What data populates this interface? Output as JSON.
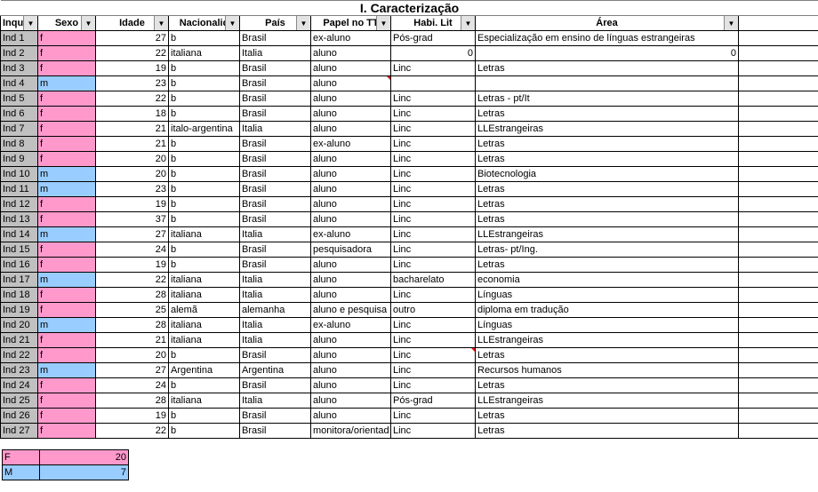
{
  "title": "I. Caracterização",
  "headers": {
    "id": "Inquiric",
    "sexo": "Sexo",
    "idade": "Idade",
    "nac": "Nacionalid",
    "pais": "País",
    "papel": "Papel no TT",
    "habi": "Habi. Lit",
    "area": "Área"
  },
  "rows": [
    {
      "id": "Ind 1",
      "sexo": "f",
      "idade": "27",
      "nac": "b",
      "pais": "Brasil",
      "papel": "ex-aluno",
      "habi": "Pós-grad",
      "area": "Especialização em ensino de línguas estrangeiras"
    },
    {
      "id": "Ind 2",
      "sexo": "f",
      "idade": "22",
      "nac": "italiana",
      "pais": "Italia",
      "papel": "aluno",
      "habi": "0",
      "area": "0",
      "habi_num": true,
      "area_num": true
    },
    {
      "id": "Ind 3",
      "sexo": "f",
      "idade": "19",
      "nac": "b",
      "pais": "Brasil",
      "papel": "aluno",
      "habi": "Linc",
      "area": "Letras"
    },
    {
      "id": "Ind 4",
      "sexo": "m",
      "idade": "23",
      "nac": "b",
      "pais": "Brasil",
      "papel": "aluno",
      "habi": "",
      "area": "",
      "papel_mark": true
    },
    {
      "id": "Ind 5",
      "sexo": "f",
      "idade": "22",
      "nac": "b",
      "pais": "Brasil",
      "papel": "aluno",
      "habi": "Linc",
      "area": "Letras - pt/It"
    },
    {
      "id": "Ind 6",
      "sexo": "f",
      "idade": "18",
      "nac": "b",
      "pais": "Brasil",
      "papel": "aluno",
      "habi": "Linc",
      "area": "Letras"
    },
    {
      "id": "Ind 7",
      "sexo": "f",
      "idade": "21",
      "nac": "italo-argentina",
      "pais": "Italia",
      "papel": "aluno",
      "habi": "Linc",
      "area": "LLEstrangeiras"
    },
    {
      "id": "Ind 8",
      "sexo": "f",
      "idade": "21",
      "nac": "b",
      "pais": "Brasil",
      "papel": "ex-aluno",
      "habi": "Linc",
      "area": "Letras"
    },
    {
      "id": "Ind 9",
      "sexo": "f",
      "idade": "20",
      "nac": "b",
      "pais": "Brasil",
      "papel": "aluno",
      "habi": "Linc",
      "area": "Letras"
    },
    {
      "id": "Ind 10",
      "sexo": "m",
      "idade": "20",
      "nac": "b",
      "pais": "Brasil",
      "papel": "aluno",
      "habi": "Linc",
      "area": "Biotecnologia"
    },
    {
      "id": "Ind 11",
      "sexo": "m",
      "idade": "23",
      "nac": "b",
      "pais": "Brasil",
      "papel": "aluno",
      "habi": "Linc",
      "area": "Letras"
    },
    {
      "id": "Ind 12",
      "sexo": "f",
      "idade": "19",
      "nac": "b",
      "pais": "Brasil",
      "papel": "aluno",
      "habi": "Linc",
      "area": "Letras"
    },
    {
      "id": "Ind 13",
      "sexo": "f",
      "idade": "37",
      "nac": "b",
      "pais": "Brasil",
      "papel": "aluno",
      "habi": "Linc",
      "area": "Letras"
    },
    {
      "id": "Ind 14",
      "sexo": "m",
      "idade": "27",
      "nac": "italiana",
      "pais": "Italia",
      "papel": "ex-aluno",
      "habi": "Linc",
      "area": "LLEstrangeiras"
    },
    {
      "id": "Ind 15",
      "sexo": "f",
      "idade": "24",
      "nac": "b",
      "pais": "Brasil",
      "papel": "pesquisadora",
      "habi": "Linc",
      "area": "Letras- pt/Ing."
    },
    {
      "id": "Ind 16",
      "sexo": "f",
      "idade": "19",
      "nac": "b",
      "pais": "Brasil",
      "papel": "aluno",
      "habi": "Linc",
      "area": "Letras"
    },
    {
      "id": "Ind 17",
      "sexo": "m",
      "idade": "22",
      "nac": "italiana",
      "pais": "Italia",
      "papel": "aluno",
      "habi": "bacharelato",
      "area": "economia"
    },
    {
      "id": "Ind 18",
      "sexo": "f",
      "idade": "28",
      "nac": "italiana",
      "pais": "Italia",
      "papel": "aluno",
      "habi": "Linc",
      "area": "Línguas"
    },
    {
      "id": "Ind 19",
      "sexo": "f",
      "idade": "25",
      "nac": "alemã",
      "pais": "alemanha",
      "papel": "aluno e pesquisa",
      "habi": "outro",
      "area": "diploma em tradução"
    },
    {
      "id": "Ind 20",
      "sexo": "m",
      "idade": "28",
      "nac": "italiana",
      "pais": "Italia",
      "papel": "ex-aluno",
      "habi": "Linc",
      "area": "Línguas"
    },
    {
      "id": "Ind 21",
      "sexo": "f",
      "idade": "21",
      "nac": "italiana",
      "pais": "Italia",
      "papel": "aluno",
      "habi": "Linc",
      "area": "LLEstrangeiras"
    },
    {
      "id": "Ind 22",
      "sexo": "f",
      "idade": "20",
      "nac": "b",
      "pais": "Brasil",
      "papel": "aluno",
      "habi": "Linc",
      "area": "Letras",
      "habi_mark": true
    },
    {
      "id": "Ind 23",
      "sexo": "m",
      "idade": "27",
      "nac": "Argentina",
      "pais": "Argentina",
      "papel": "aluno",
      "habi": "Linc",
      "area": "Recursos humanos"
    },
    {
      "id": "Ind 24",
      "sexo": "f",
      "idade": "24",
      "nac": "b",
      "pais": "Brasil",
      "papel": "aluno",
      "habi": "Linc",
      "area": "Letras"
    },
    {
      "id": "Ind 25",
      "sexo": "f",
      "idade": "28",
      "nac": "italiana",
      "pais": "Italia",
      "papel": "aluno",
      "habi": "Pós-grad",
      "area": "LLEstrangeiras"
    },
    {
      "id": "Ind 26",
      "sexo": "f",
      "idade": "19",
      "nac": "b",
      "pais": "Brasil",
      "papel": "aluno",
      "habi": "Linc",
      "area": "Letras"
    },
    {
      "id": "Ind 27",
      "sexo": "f",
      "idade": "22",
      "nac": "b",
      "pais": "Brasil",
      "papel": "monitora/orientad",
      "habi": "Linc",
      "area": "Letras"
    }
  ],
  "summary": {
    "f_label": "F",
    "f_count": "20",
    "m_label": "M",
    "m_count": "7"
  }
}
